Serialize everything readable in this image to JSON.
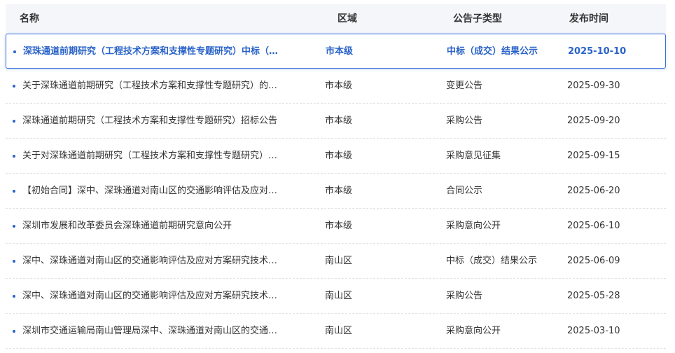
{
  "columns": {
    "name": "名称",
    "region": "区域",
    "type": "公告子类型",
    "date": "发布时间"
  },
  "rows": [
    {
      "name": "深珠通道前期研究（工程技术方案和支撑性专题研究）中标（…",
      "region": "市本级",
      "type": "中标（成交）结果公示",
      "date": "2025-10-10"
    },
    {
      "name": "关于深珠通道前期研究（工程技术方案和支撑性专题研究）的…",
      "region": "市本级",
      "type": "变更公告",
      "date": "2025-09-30"
    },
    {
      "name": "深珠通道前期研究（工程技术方案和支撑性专题研究）招标公告",
      "region": "市本级",
      "type": "采购公告",
      "date": "2025-09-20"
    },
    {
      "name": "关于对深珠通道前期研究（工程技术方案和支撑性专题研究）…",
      "region": "市本级",
      "type": "采购意见征集",
      "date": "2025-09-15"
    },
    {
      "name": "【初始合同】深中、深珠通道对南山区的交通影响评估及应对…",
      "region": "市本级",
      "type": "合同公示",
      "date": "2025-06-20"
    },
    {
      "name": "深圳市发展和改革委员会深珠通道前期研究意向公开",
      "region": "市本级",
      "type": "采购意向公开",
      "date": "2025-06-10"
    },
    {
      "name": "深中、深珠通道对南山区的交通影响评估及应对方案研究技术…",
      "region": "南山区",
      "type": "中标（成交）结果公示",
      "date": "2025-06-09"
    },
    {
      "name": "深中、深珠通道对南山区的交通影响评估及应对方案研究技术…",
      "region": "南山区",
      "type": "采购公告",
      "date": "2025-05-28"
    },
    {
      "name": "深圳市交通运输局南山管理局深中、深珠通道对南山区的交通…",
      "region": "南山区",
      "type": "采购意向公开",
      "date": "2025-03-10"
    }
  ],
  "colors": {
    "accent": "#2a63c8",
    "header_bg": "#f4f6fa"
  }
}
